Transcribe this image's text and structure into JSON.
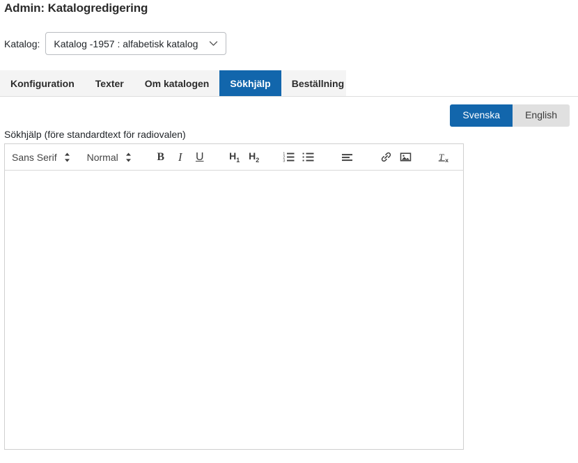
{
  "page": {
    "title": "Admin: Katalogredigering"
  },
  "catalog": {
    "label": "Katalog:",
    "selected": "Katalog -1957 : alfabetisk katalog",
    "chevron_icon": "chevron-down-icon"
  },
  "tabs": [
    {
      "label": "Konfiguration",
      "active": false
    },
    {
      "label": "Texter",
      "active": false
    },
    {
      "label": "Om katalogen",
      "active": false
    },
    {
      "label": "Sökhjälp",
      "active": true
    },
    {
      "label": "Beställning",
      "active": false
    }
  ],
  "language": {
    "swedish": "Svenska",
    "english": "English",
    "active": "Svenska"
  },
  "editor": {
    "field_label": "Sökhjälp (före standardtext för radiovalen)",
    "content": "",
    "toolbar": {
      "font_family": "Sans Serif",
      "font_size": "Normal",
      "bold": "B",
      "italic": "I",
      "underline": "U",
      "heading1": "H",
      "heading1_sub": "1",
      "heading2": "H",
      "heading2_sub": "2",
      "ordered_list_icon": "ordered-list-icon",
      "bullet_list_icon": "bullet-list-icon",
      "align_icon": "align-left-icon",
      "link_icon": "link-icon",
      "image_icon": "image-icon",
      "clear_format_icon": "clear-formatting-icon"
    }
  },
  "colors": {
    "accent": "#1266ac",
    "tab_bar_bg": "#f4f4f4",
    "inactive_lang_bg": "#e0e0e0",
    "border": "#cfcfcf"
  }
}
